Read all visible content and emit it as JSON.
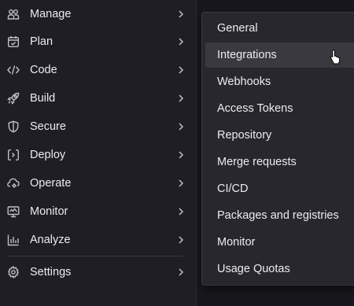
{
  "sidebar": {
    "items": [
      {
        "label": "Manage",
        "icon": "users-icon"
      },
      {
        "label": "Plan",
        "icon": "calendar-check-icon"
      },
      {
        "label": "Code",
        "icon": "code-icon"
      },
      {
        "label": "Build",
        "icon": "rocket-icon"
      },
      {
        "label": "Secure",
        "icon": "shield-icon"
      },
      {
        "label": "Deploy",
        "icon": "deploy-icon"
      },
      {
        "label": "Operate",
        "icon": "cloud-gear-icon"
      },
      {
        "label": "Monitor",
        "icon": "monitor-icon"
      },
      {
        "label": "Analyze",
        "icon": "chart-icon"
      },
      {
        "label": "Settings",
        "icon": "gear-icon"
      }
    ]
  },
  "flyout": {
    "items": [
      {
        "label": "General"
      },
      {
        "label": "Integrations"
      },
      {
        "label": "Webhooks"
      },
      {
        "label": "Access Tokens"
      },
      {
        "label": "Repository"
      },
      {
        "label": "Merge requests"
      },
      {
        "label": "CI/CD"
      },
      {
        "label": "Packages and registries"
      },
      {
        "label": "Monitor"
      },
      {
        "label": "Usage Quotas"
      }
    ],
    "active_item": "Integrations"
  },
  "colors": {
    "background": "#1f1e24",
    "flyout_background": "#28272d",
    "hover_background": "#3a3940",
    "text": "#ececef",
    "icon": "#bfbfc3"
  }
}
